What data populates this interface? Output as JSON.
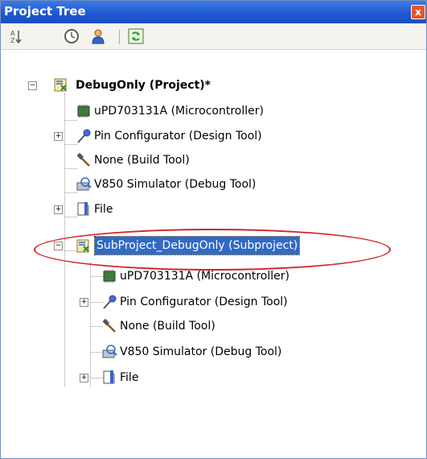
{
  "window": {
    "title": "Project Tree",
    "close_glyph": "x"
  },
  "toolbar": {
    "buttons": [
      {
        "name": "sort-alpha-icon"
      },
      {
        "name": "clock-icon"
      },
      {
        "name": "person-icon"
      },
      {
        "name": "refresh-icon"
      }
    ]
  },
  "tree": {
    "project": {
      "label": "DebugOnly (Project)*"
    },
    "project_items": [
      {
        "label": "uPD703131A (Microcontroller)"
      },
      {
        "label": "Pin Configurator (Design Tool)"
      },
      {
        "label": "None (Build Tool)"
      },
      {
        "label": "V850 Simulator (Debug Tool)"
      },
      {
        "label": "File"
      }
    ],
    "subproject": {
      "label": "SubProject_DebugOnly (Subproject)"
    },
    "subproject_items": [
      {
        "label": "uPD703131A (Microcontroller)"
      },
      {
        "label": "Pin Configurator (Design Tool)"
      },
      {
        "label": "None (Build Tool)"
      },
      {
        "label": "V850 Simulator (Debug Tool)"
      },
      {
        "label": "File"
      }
    ]
  },
  "colors": {
    "titlebar": "#2058d0",
    "highlight": "#d3262a",
    "selection": "#316ac5"
  }
}
